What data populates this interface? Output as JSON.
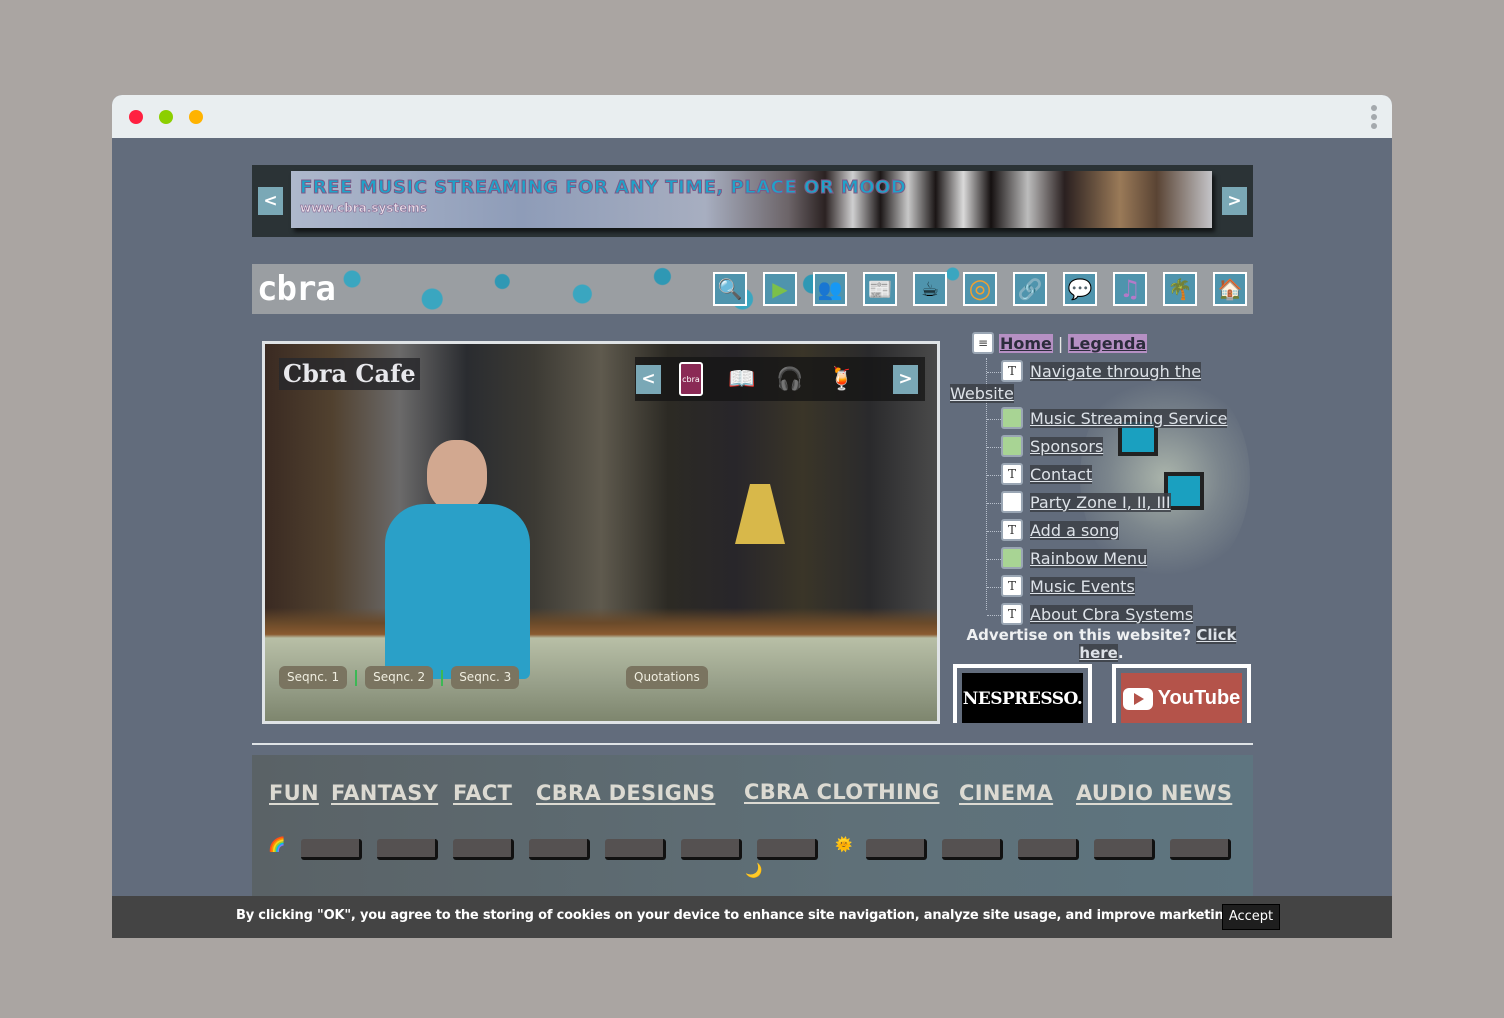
{
  "browser": {
    "controls": [
      "close",
      "minimize",
      "maximize"
    ],
    "menu_icon": "kebab-menu-icon"
  },
  "banner": {
    "prev_label": "<",
    "next_label": ">",
    "headline": "FREE MUSIC STREAMING FOR ANY TIME, PLACE OR MOOD",
    "url": "www.cbra.systems"
  },
  "header": {
    "logo": "cbra",
    "nav_icons": [
      {
        "name": "search-icon",
        "glyph": "🔍"
      },
      {
        "name": "play-icon",
        "glyph": "▶"
      },
      {
        "name": "users-icon",
        "glyph": "👥"
      },
      {
        "name": "newspaper-icon",
        "glyph": "📰"
      },
      {
        "name": "coffee-icon",
        "glyph": "☕"
      },
      {
        "name": "color-wheel-icon",
        "glyph": "◎"
      },
      {
        "name": "link-icon",
        "glyph": "🔗"
      },
      {
        "name": "speech-bubble-icon",
        "glyph": "💬"
      },
      {
        "name": "music-note-icon",
        "glyph": "♫"
      },
      {
        "name": "palm-tree-icon",
        "glyph": "🌴"
      },
      {
        "name": "house-icon",
        "glyph": "🏠"
      }
    ]
  },
  "slideshow": {
    "title": "Cbra Cafe",
    "prev_label": "<",
    "next_label": ">",
    "card_text": "cbra",
    "icons": [
      {
        "name": "card-icon",
        "glyph": "cbra"
      },
      {
        "name": "book-icon",
        "glyph": "📖"
      },
      {
        "name": "headphones-icon",
        "glyph": "🎧"
      },
      {
        "name": "cocktail-icon",
        "glyph": "🍹"
      }
    ],
    "sequences": [
      "Seqnc. 1",
      "Seqnc. 2",
      "Seqnc. 3"
    ],
    "quotations_label": "Quotations"
  },
  "sidebar": {
    "home_label": "Home",
    "separator": "|",
    "legenda_label": "Legenda",
    "items": [
      {
        "label": "Navigate through the Website",
        "icon": "T",
        "type": "text"
      },
      {
        "label": "Music Streaming Service",
        "icon": "",
        "type": "green"
      },
      {
        "label": "Sponsors",
        "icon": "",
        "type": "green"
      },
      {
        "label": "Contact",
        "icon": "T",
        "type": "text"
      },
      {
        "label": "Party Zone I, II, III",
        "icon": "",
        "type": "blank"
      },
      {
        "label": "Add a song",
        "icon": "T",
        "type": "text"
      },
      {
        "label": "Rainbow Menu",
        "icon": "",
        "type": "green"
      },
      {
        "label": "Music Events",
        "icon": "T",
        "type": "text"
      },
      {
        "label": "About Cbra Systems",
        "icon": "T",
        "type": "text"
      }
    ],
    "nav_line1": "Navigate through the",
    "nav_line2": "Website",
    "advertise_text": "Advertise on this website? ",
    "advertise_link1": "Click",
    "advertise_link2": "here",
    "advertise_end": ".",
    "ads": [
      {
        "name": "nespresso-ad",
        "label": "NESPRESSO."
      },
      {
        "name": "youtube-ad",
        "label": "YouTube"
      }
    ]
  },
  "bottom_menu": {
    "categories": [
      "FUN",
      "FANTASY",
      "FACT",
      "CBRA DESIGNS",
      "CBRA CLOTHING",
      "CINEMA",
      "AUDIO NEWS"
    ],
    "rainbow_glyph": "🌈",
    "sun_glyph": "🌞",
    "moon_glyph": "🌙",
    "slot_count": 12
  },
  "cookie": {
    "text": "By clicking \"OK\", you agree to the storing of cookies on your device to enhance site navigation, analyze site usage, and improve marketing.",
    "accept_label": "Accept"
  },
  "colors": {
    "page_bg": "#626c7c",
    "accent_button": "#7aa8b6",
    "nav_icon_bg": "#4f94ad",
    "highlight": "#b690c4",
    "cookie_bg": "#444444"
  }
}
